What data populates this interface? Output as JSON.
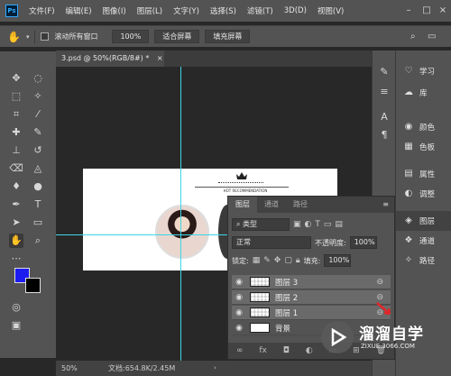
{
  "app": {
    "logo": "Ps"
  },
  "menu": [
    "文件(F)",
    "编辑(E)",
    "图像(I)",
    "图层(L)",
    "文字(Y)",
    "选择(S)",
    "滤镜(T)",
    "3D(D)",
    "视图(V)"
  ],
  "options": {
    "scroll_all": "滚动所有窗口",
    "zoom": "100%",
    "fit_screen": "适合屏幕",
    "fill_screen": "填充屏幕"
  },
  "document": {
    "tab": "3.psd @ 50%(RGB/8#) *",
    "close": "×",
    "banner_text": "HOT RECOMMENDATION"
  },
  "status": {
    "zoom": "50%",
    "doc_info": "文档:654.8K/2.45M"
  },
  "right_panel": [
    {
      "label": "学习",
      "icon": "bulb-icon"
    },
    {
      "label": "库",
      "icon": "library-icon"
    },
    {
      "label": "颜色",
      "icon": "palette-icon"
    },
    {
      "label": "色板",
      "icon": "swatches-icon"
    },
    {
      "label": "属性",
      "icon": "properties-icon"
    },
    {
      "label": "调整",
      "icon": "adjust-icon"
    },
    {
      "label": "图层",
      "icon": "layers-icon"
    },
    {
      "label": "通道",
      "icon": "channels-icon"
    },
    {
      "label": "路径",
      "icon": "paths-icon"
    }
  ],
  "layers_panel": {
    "tabs": [
      "图层",
      "通道",
      "路径"
    ],
    "filter": "类型",
    "blend_mode": "正常",
    "opacity_label": "不透明度:",
    "opacity_value": "100%",
    "lock_label": "锁定:",
    "fill_label": "填充:",
    "fill_value": "100%",
    "layers": [
      {
        "name": "图层 3"
      },
      {
        "name": "图层 2"
      },
      {
        "name": "图层 1"
      },
      {
        "name": "背景"
      }
    ]
  },
  "watermark": {
    "title": "溜溜自学",
    "subtitle": "ZIXUE.3066.COM"
  },
  "colors": {
    "foreground": "#1c1cf0",
    "background": "#000000",
    "guide": "#3cd6e6"
  }
}
